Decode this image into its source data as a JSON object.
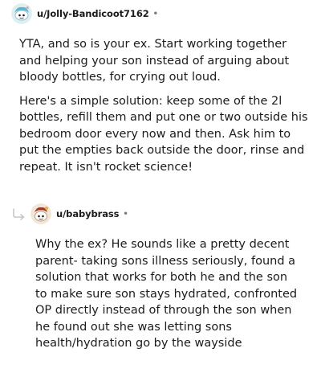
{
  "comments": [
    {
      "username": "u/Jolly-Bandicoot7162",
      "separator": "•",
      "avatar_icon": "snoo-avatar-icon",
      "paragraphs": [
        "YTA, and so is your ex. Start working together and helping your son instead of arguing about bloody bottles, for crying out loud.",
        "Here's a simple solution: keep some of the 2l bottles, refill them and put one or two outside his bedroom door every now and then. Ask him to put the empties back outside the door, rinse and repeat. It isn't rocket science!"
      ]
    },
    {
      "username": "u/babybrass",
      "separator": "•",
      "avatar_icon": "snoo-avatar-icon",
      "reply_icon": "reply-arrow-icon",
      "paragraphs": [
        "Why the ex? He sounds like a pretty decent parent- taking sons illness seriously, found a solution that works for both he and the son to make sure son stays hydrated, confronted OP directly instead of through the son when he found out she was letting sons health/hydration go by the wayside"
      ]
    }
  ],
  "colors": {
    "text": "#1c1c1c",
    "meta": "#787c7e",
    "avatar1_bg": "#dfeef2",
    "avatar2_bg": "#f3e6d6"
  }
}
